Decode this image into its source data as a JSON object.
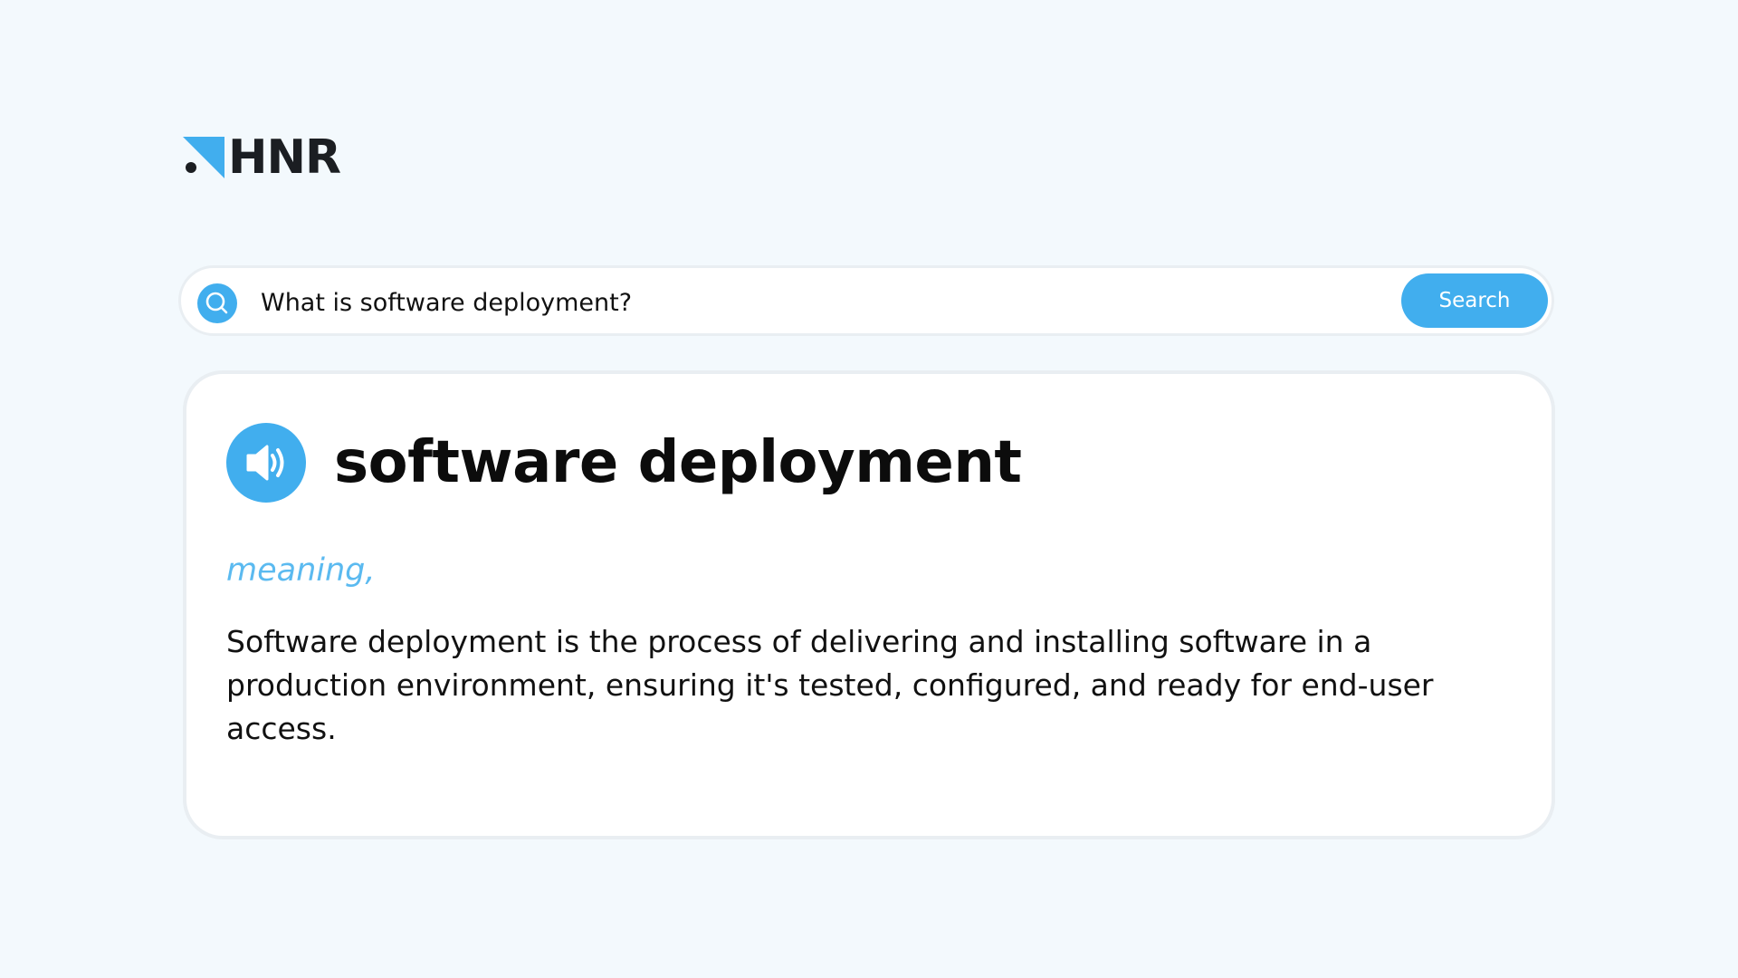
{
  "logo": {
    "text": "HNR",
    "icon": "hnr-logo-mark-icon",
    "accent_color": "#41aeee"
  },
  "search": {
    "icon": "search-icon",
    "value": "What is software deployment?",
    "button_label": "Search"
  },
  "result": {
    "speaker_icon": "speaker-icon",
    "term": "software deployment",
    "meaning_label": "meaning,",
    "definition": "Software deployment is the process of delivering and installing software in a production environment, ensuring it's tested, configured, and ready for end-user access."
  },
  "colors": {
    "accent": "#41aeee",
    "meaning": "#5bbaf0",
    "background": "#f3f9fd"
  }
}
